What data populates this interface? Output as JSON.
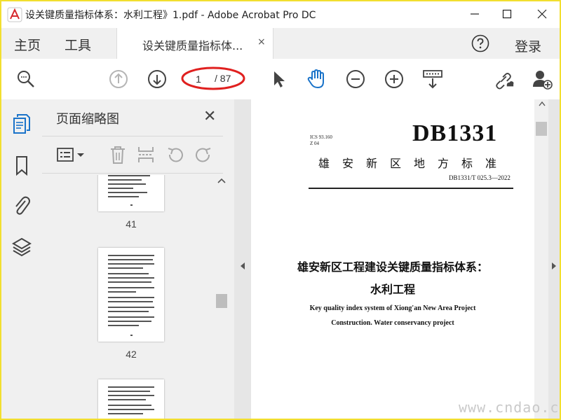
{
  "window": {
    "title": "设关键质量指标体系：水利工程》1.pdf - Adobe Acrobat Pro DC",
    "minimize_glyph": "—",
    "maximize_glyph": "☐",
    "close_glyph": "✕"
  },
  "menubar": {
    "home": "主页",
    "tools": "工具",
    "tab_label": "设关键质量指标体...",
    "tab_close": "×",
    "login": "登录"
  },
  "toolbar": {
    "current_page": "1",
    "total_pages": "/ 87",
    "highlight_color": "#e0201f",
    "accent_color": "#1a73c9"
  },
  "thumbnails": {
    "title": "页面缩略图",
    "close": "✕",
    "pages": [
      {
        "label": "41"
      },
      {
        "label": "42"
      }
    ]
  },
  "document": {
    "ics": "ICS 93.160",
    "z": "Z 04",
    "code_big": "DB1331",
    "standard_name": "雄安新区地方标准",
    "standard_code": "DB1331/T 025.3—2022",
    "title_line1": "雄安新区工程建设关键质量指标体系：",
    "title_line2": "水利工程",
    "english_line1": "Key quality index system of Xiong'an New Area Project",
    "english_line2": "Construction. Water conservancy project"
  },
  "watermark": "www.cndao.com"
}
